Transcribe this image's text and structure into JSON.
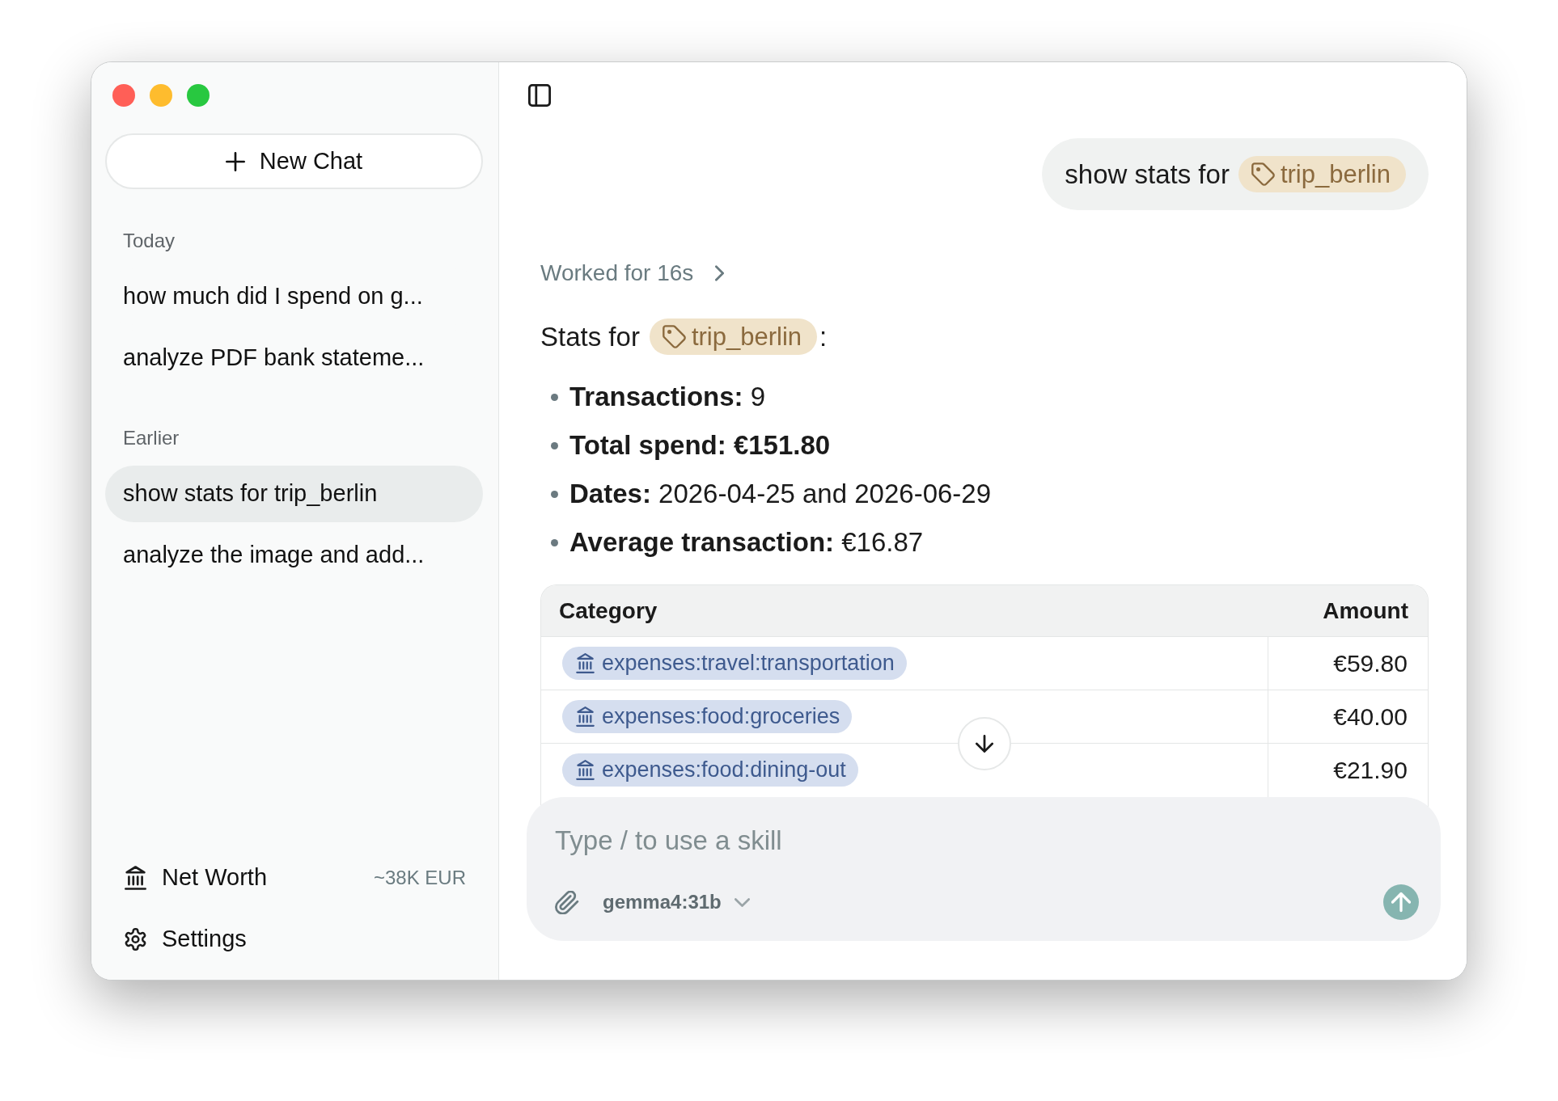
{
  "sidebar": {
    "new_chat_label": "New Chat",
    "sections": [
      {
        "title": "Today",
        "items": [
          {
            "label": "how much did I spend on g...",
            "selected": false
          },
          {
            "label": "analyze PDF bank stateme...",
            "selected": false
          }
        ]
      },
      {
        "title": "Earlier",
        "items": [
          {
            "label": "show stats for trip_berlin",
            "selected": true
          },
          {
            "label": "analyze the image and add...",
            "selected": false
          }
        ]
      }
    ],
    "footer": {
      "net_worth": {
        "label": "Net Worth",
        "value": "~38K EUR"
      },
      "settings": {
        "label": "Settings"
      }
    }
  },
  "conversation": {
    "user_message": {
      "text": "show stats for",
      "tag": "trip_berlin"
    },
    "work_summary": {
      "label": "Worked for 16s",
      "expanded": false
    },
    "reply": {
      "heading": {
        "text": "Stats for",
        "tag": "trip_berlin",
        "suffix": ":"
      },
      "stats": [
        {
          "label": "Transactions:",
          "value": "9",
          "value_bold": false
        },
        {
          "label": "Total spend:",
          "value": "€151.80",
          "value_bold": true
        },
        {
          "label": "Dates:",
          "value": "2026-04-25 and 2026-06-29",
          "value_bold": false
        },
        {
          "label": "Average transaction:",
          "value": "€16.87",
          "value_bold": false
        }
      ],
      "table": {
        "columns": [
          "Category",
          "Amount"
        ],
        "rows": [
          {
            "category": "expenses:travel:transportation",
            "amount": "€59.80"
          },
          {
            "category": "expenses:food:groceries",
            "amount": "€40.00"
          },
          {
            "category": "expenses:food:dining-out",
            "amount": "€21.90"
          }
        ]
      }
    }
  },
  "composer": {
    "placeholder": "Type / to use a skill",
    "model": "gemma4:31b"
  }
}
